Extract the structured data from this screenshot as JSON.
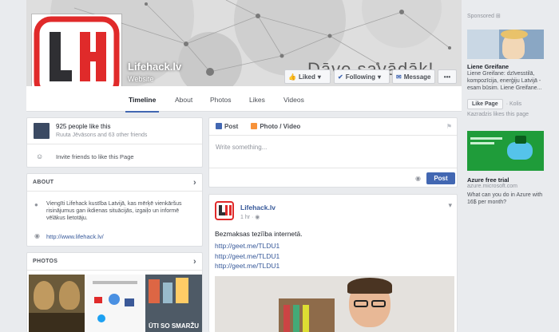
{
  "colors": {
    "brand_blue": "#4267b2",
    "link": "#365899",
    "logo_red": "#e02a2a",
    "logo_dark": "#2f2f33"
  },
  "cover": {
    "tagline": "Dāve savādāk!"
  },
  "page": {
    "name": "Lifehack.lv",
    "category": "Website",
    "logo_text": "LH"
  },
  "actions": {
    "liked": "Liked",
    "following": "Following",
    "message": "Message",
    "more": "•••"
  },
  "tabs": [
    "Timeline",
    "About",
    "Photos",
    "Likes",
    "Videos"
  ],
  "likes_box": {
    "count_text": "925 people like this",
    "friends_text": "Ruuta Jēvāsons and 63 other friends",
    "invite_text": "Invite friends to like this Page"
  },
  "about": {
    "header": "ABOUT",
    "description": "Viengīti Lifehack kustība Latvijā, kas mērķē vienkāršus risinājumus gan ikdienas situācijās, izgaiļo un informē vēlākus lietotāju.",
    "website": "http://www.lifehack.lv/"
  },
  "photos": {
    "header": "PHOTOS",
    "thumb_caption": "ŪTI SO SMARŽU"
  },
  "composer": {
    "tab_post": "Post",
    "tab_photo": "Photo / Video",
    "placeholder": "Write something...",
    "post_button": "Post"
  },
  "post": {
    "author": "Lifehack.lv",
    "time": "1 hr · ",
    "text": "Bezmaksas tezīība internetā.",
    "links": [
      "http://geet.me/TLDU1",
      "http://geet.me/TLDU1",
      "http://geet.me/TLDU1"
    ]
  },
  "sidebar": {
    "sponsored": "Sponsored",
    "ad1": {
      "title": "Liene Greifane",
      "text": "Liene Greifane: dzīvesstilā, kompozīcija, enerģiju Latvijā - esam būsim. Liene Greifane...",
      "like_button": "Like Page",
      "like_count": "· Kolis",
      "liked_by": "Kazradzis likes this page"
    },
    "ad2": {
      "title": "Azure free trial",
      "domain": "azure.microsoft.com",
      "text": "What can you do in Azure with 16$ per month?"
    }
  }
}
